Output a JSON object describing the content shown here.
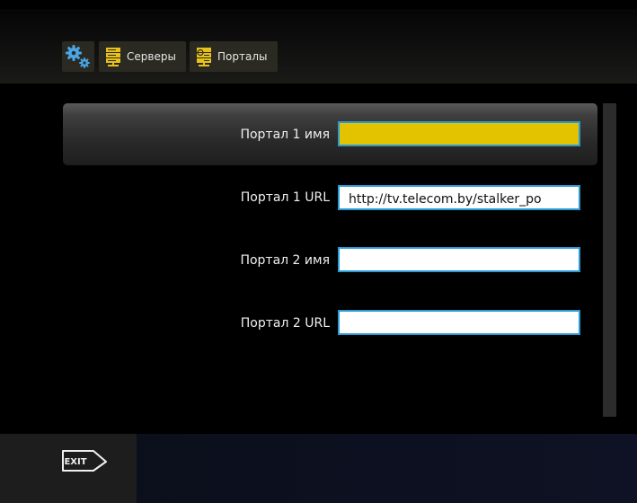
{
  "breadcrumb": {
    "settings_icon": "gear-icon",
    "servers_label": "Серверы",
    "portals_label": "Порталы"
  },
  "fields": [
    {
      "label": "Портал 1 имя",
      "value": ""
    },
    {
      "label": "Портал 1 URL",
      "value": "http://tv.telecom.by/stalker_po"
    },
    {
      "label": "Портал 2 имя",
      "value": ""
    },
    {
      "label": "Портал 2 URL",
      "value": ""
    }
  ],
  "footer": {
    "exit_label": "EXIT"
  },
  "colors": {
    "active_field": "#e3c200",
    "field_border": "#2a9ad6",
    "icon_yellow": "#e8c21a"
  }
}
